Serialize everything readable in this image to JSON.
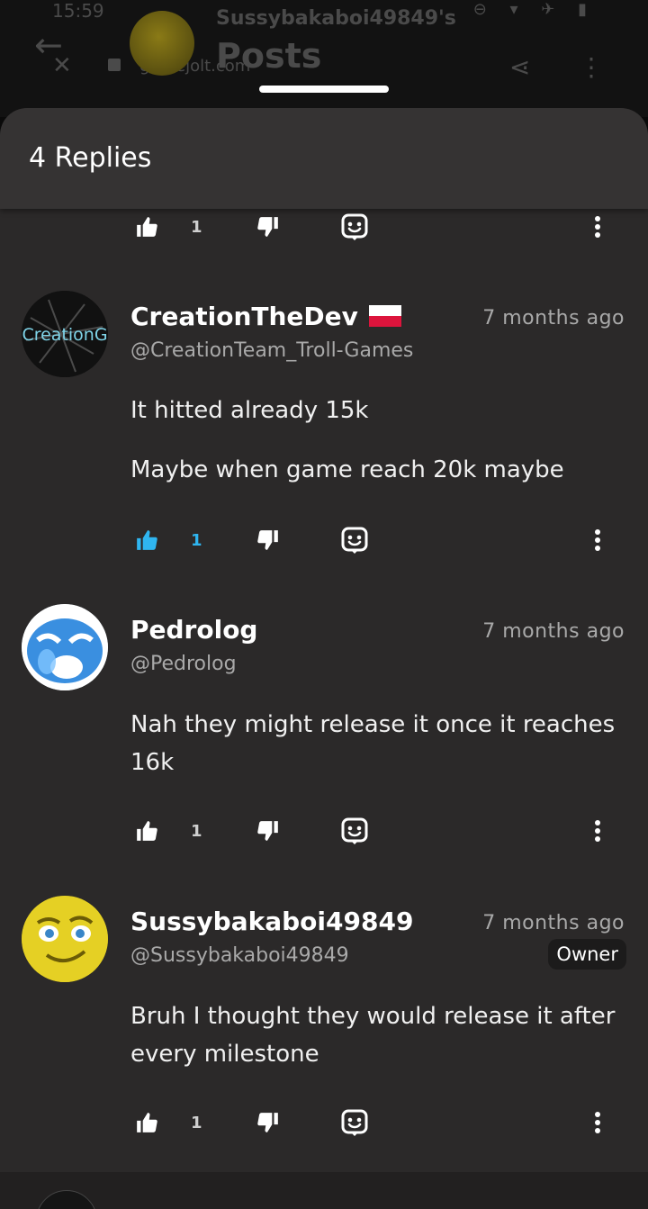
{
  "background": {
    "status_time": "15:59",
    "status_icons": "⊖ ▾ ✈ ▮",
    "back_icon": "arrow-left",
    "close_icon": "close",
    "url": "gamejolt.com",
    "title_line1": "Sussybakaboi49849's",
    "title_line2": "Posts"
  },
  "sheet": {
    "title": "4 Replies"
  },
  "top_actions": {
    "like_count": "1"
  },
  "comments": [
    {
      "name": "CreationTheDev",
      "handle": "@CreationTeam_Troll-Games",
      "time": "7 months ago",
      "lines": [
        "It hitted already 15k",
        "Maybe when game reach 20k maybe"
      ],
      "like_count": "1",
      "liked": true,
      "avatar_text": "CreationG"
    },
    {
      "name": "Pedrolog",
      "handle": "@Pedrolog",
      "time": "7 months ago",
      "lines": [
        "Nah they might release it once it reaches 16k"
      ],
      "like_count": "1",
      "liked": false
    },
    {
      "name": "Sussybakaboi49849",
      "handle": "@Sussybakaboi49849",
      "time": "7 months ago",
      "badge": "Owner",
      "lines": [
        "Bruh I thought they would release it after every milestone"
      ],
      "like_count": "1",
      "liked": false
    }
  ],
  "colors": {
    "accent_like": "#2fb5f0",
    "sheet_bg": "#2b2929",
    "header_bg": "#353333"
  }
}
